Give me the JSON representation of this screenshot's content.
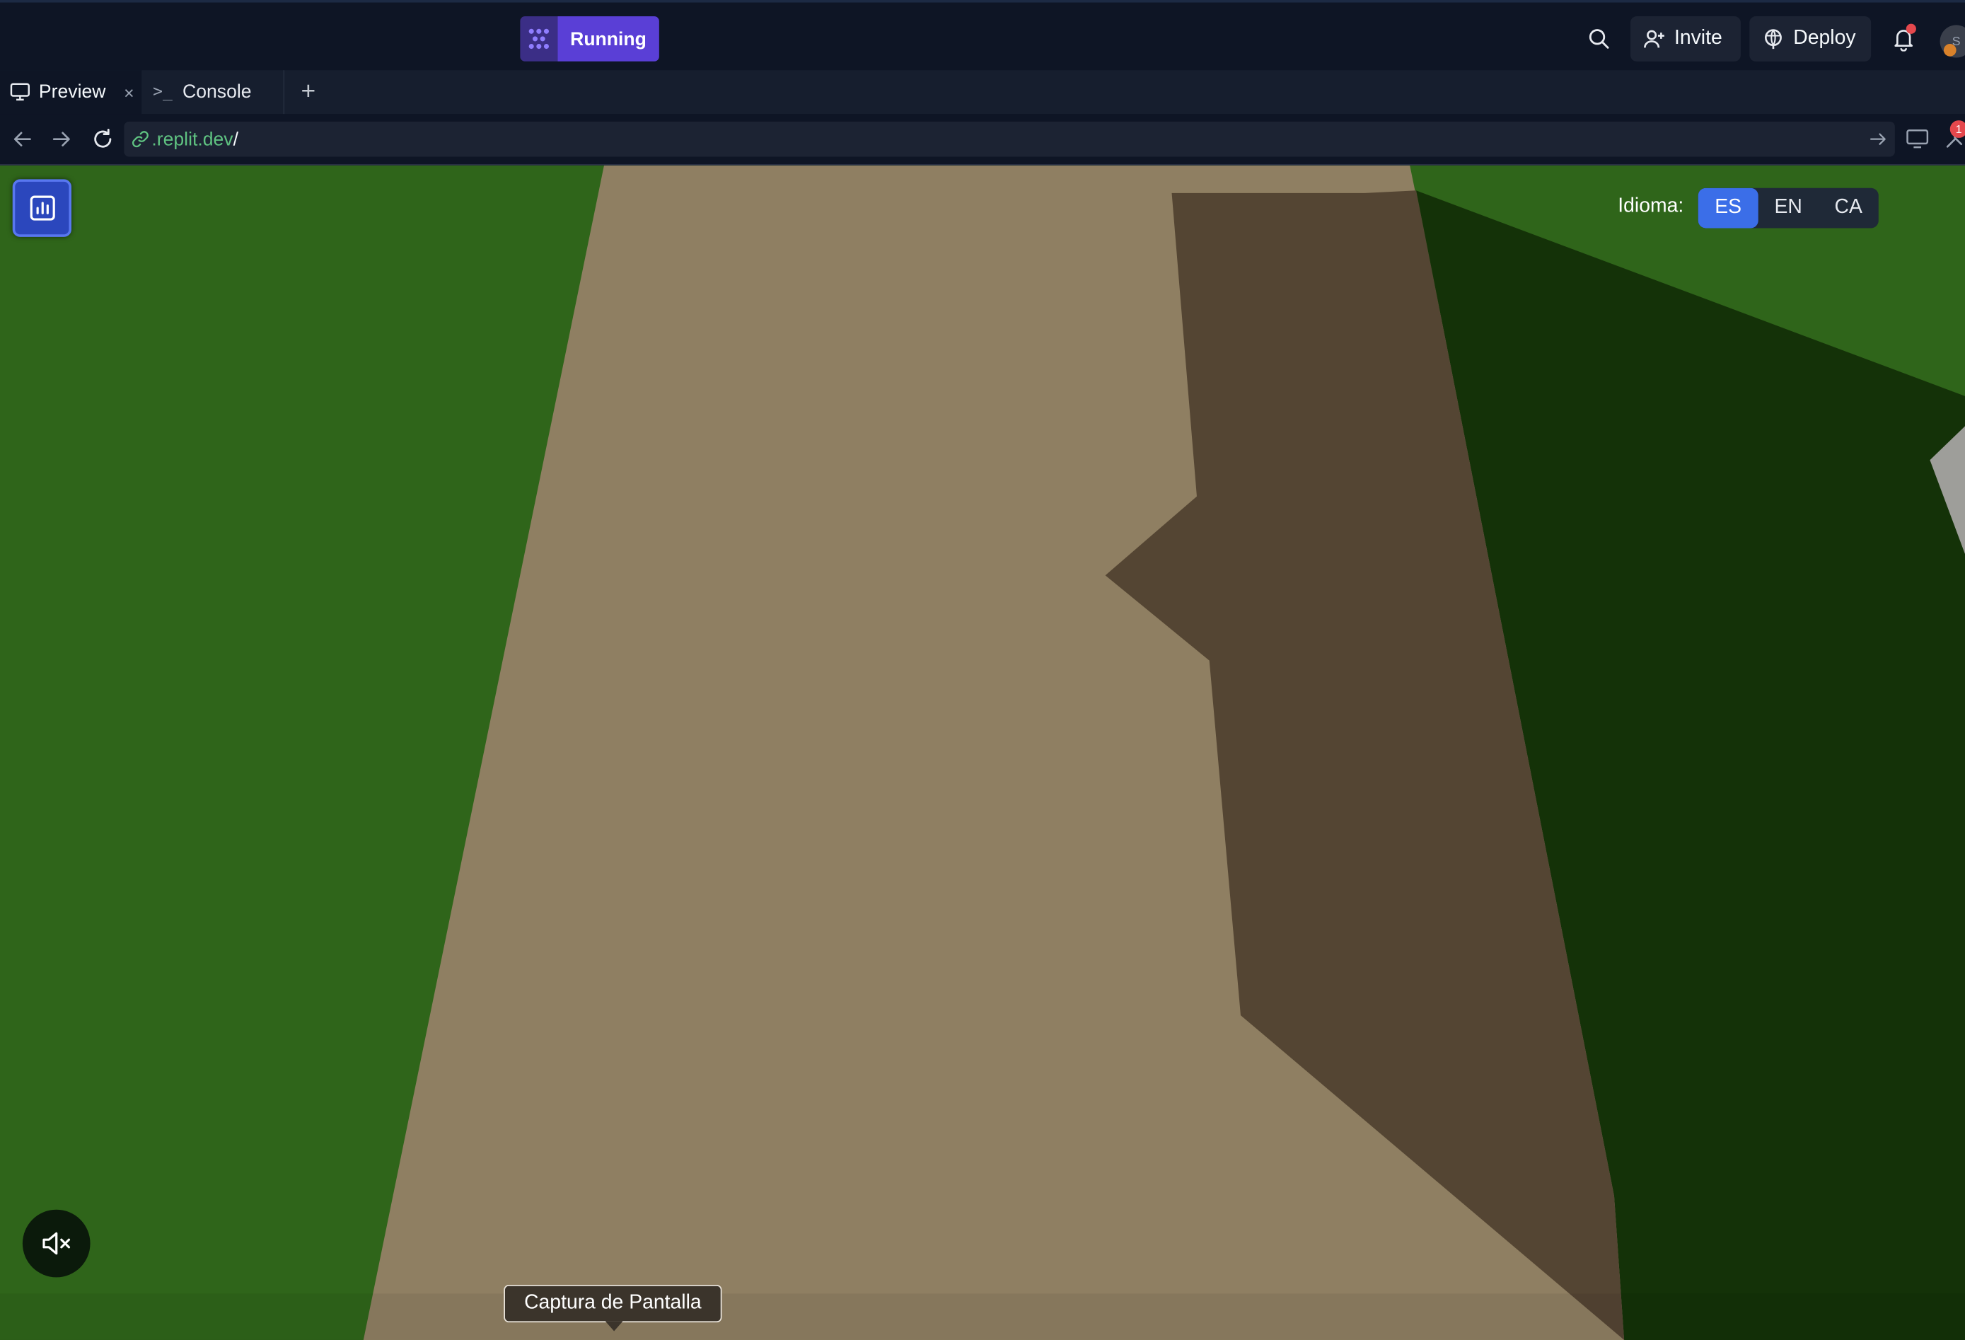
{
  "topbar": {
    "run_status": "Running",
    "invite_label": "Invite",
    "deploy_label": "Deploy",
    "avatar_initial": "S"
  },
  "tabs": [
    {
      "label": "Preview",
      "close": "×",
      "active": true
    },
    {
      "label": "Console",
      "prefix": ">_"
    }
  ],
  "tab_add": "+",
  "address": {
    "domain": ".replit.dev",
    "path": "/",
    "tools_badge": "1"
  },
  "game": {
    "language_label": "Idioma:",
    "languages": [
      {
        "code": "ES",
        "active": true
      },
      {
        "code": "EN",
        "active": false
      },
      {
        "code": "CA",
        "active": false
      }
    ],
    "screenshot_tooltip": "Captura de Pantalla",
    "colors": {
      "grass": "#2f651a",
      "path": "#8f7f62",
      "shadow_on_path": "#544533",
      "shadow_on_grass": "#143208",
      "accent": "#3b6ee8"
    }
  },
  "colors": {
    "app_bg": "#0e1525",
    "running_accent": "#5a3fd6",
    "url_domain": "#5fc281"
  }
}
